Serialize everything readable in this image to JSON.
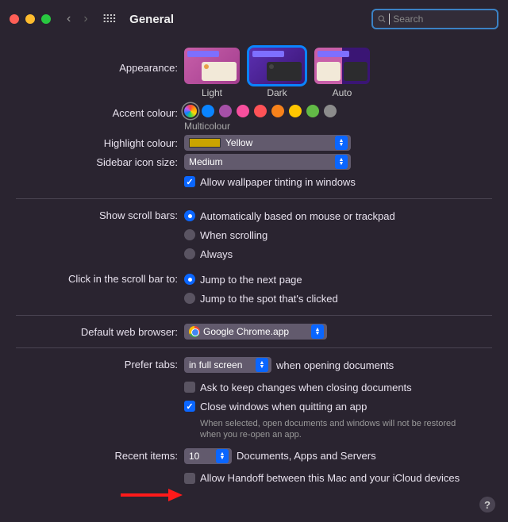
{
  "window": {
    "title": "General"
  },
  "search": {
    "placeholder": "Search"
  },
  "labels": {
    "appearance": "Appearance:",
    "accent": "Accent colour:",
    "highlight": "Highlight colour:",
    "sidebar_size": "Sidebar icon size:",
    "scroll_bars": "Show scroll bars:",
    "click_scroll": "Click in the scroll bar to:",
    "default_browser": "Default web browser:",
    "prefer_tabs": "Prefer tabs:",
    "recent_items": "Recent items:"
  },
  "appearance": {
    "options": [
      {
        "id": "light",
        "label": "Light",
        "selected": false
      },
      {
        "id": "dark",
        "label": "Dark",
        "selected": true
      },
      {
        "id": "auto",
        "label": "Auto",
        "selected": false
      }
    ]
  },
  "accent": {
    "caption": "Multicolour",
    "colors": [
      "multi",
      "#0a84ff",
      "#a550a7",
      "#f74f9e",
      "#ff5257",
      "#f7821b",
      "#ffc600",
      "#62ba46",
      "#8c8c8c"
    ],
    "selected_index": 0
  },
  "highlight": {
    "value": "Yellow"
  },
  "sidebar_size": {
    "value": "Medium"
  },
  "wallpaper_tint": {
    "checked": true,
    "label": "Allow wallpaper tinting in windows"
  },
  "scroll_bars": {
    "options": [
      {
        "label": "Automatically based on mouse or trackpad",
        "checked": true
      },
      {
        "label": "When scrolling",
        "checked": false
      },
      {
        "label": "Always",
        "checked": false
      }
    ]
  },
  "click_scroll": {
    "options": [
      {
        "label": "Jump to the next page",
        "checked": true
      },
      {
        "label": "Jump to the spot that's clicked",
        "checked": false
      }
    ]
  },
  "default_browser": {
    "value": "Google Chrome.app"
  },
  "prefer_tabs": {
    "value": "in full screen",
    "suffix": "when opening documents",
    "ask_changes": {
      "checked": false,
      "label": "Ask to keep changes when closing documents"
    },
    "close_windows": {
      "checked": true,
      "label": "Close windows when quitting an app",
      "sub": "When selected, open documents and windows will not be restored when you re-open an app."
    }
  },
  "recent_items": {
    "value": "10",
    "suffix": "Documents, Apps and Servers"
  },
  "handoff": {
    "checked": false,
    "label": "Allow Handoff between this Mac and your iCloud devices"
  },
  "help": "?"
}
